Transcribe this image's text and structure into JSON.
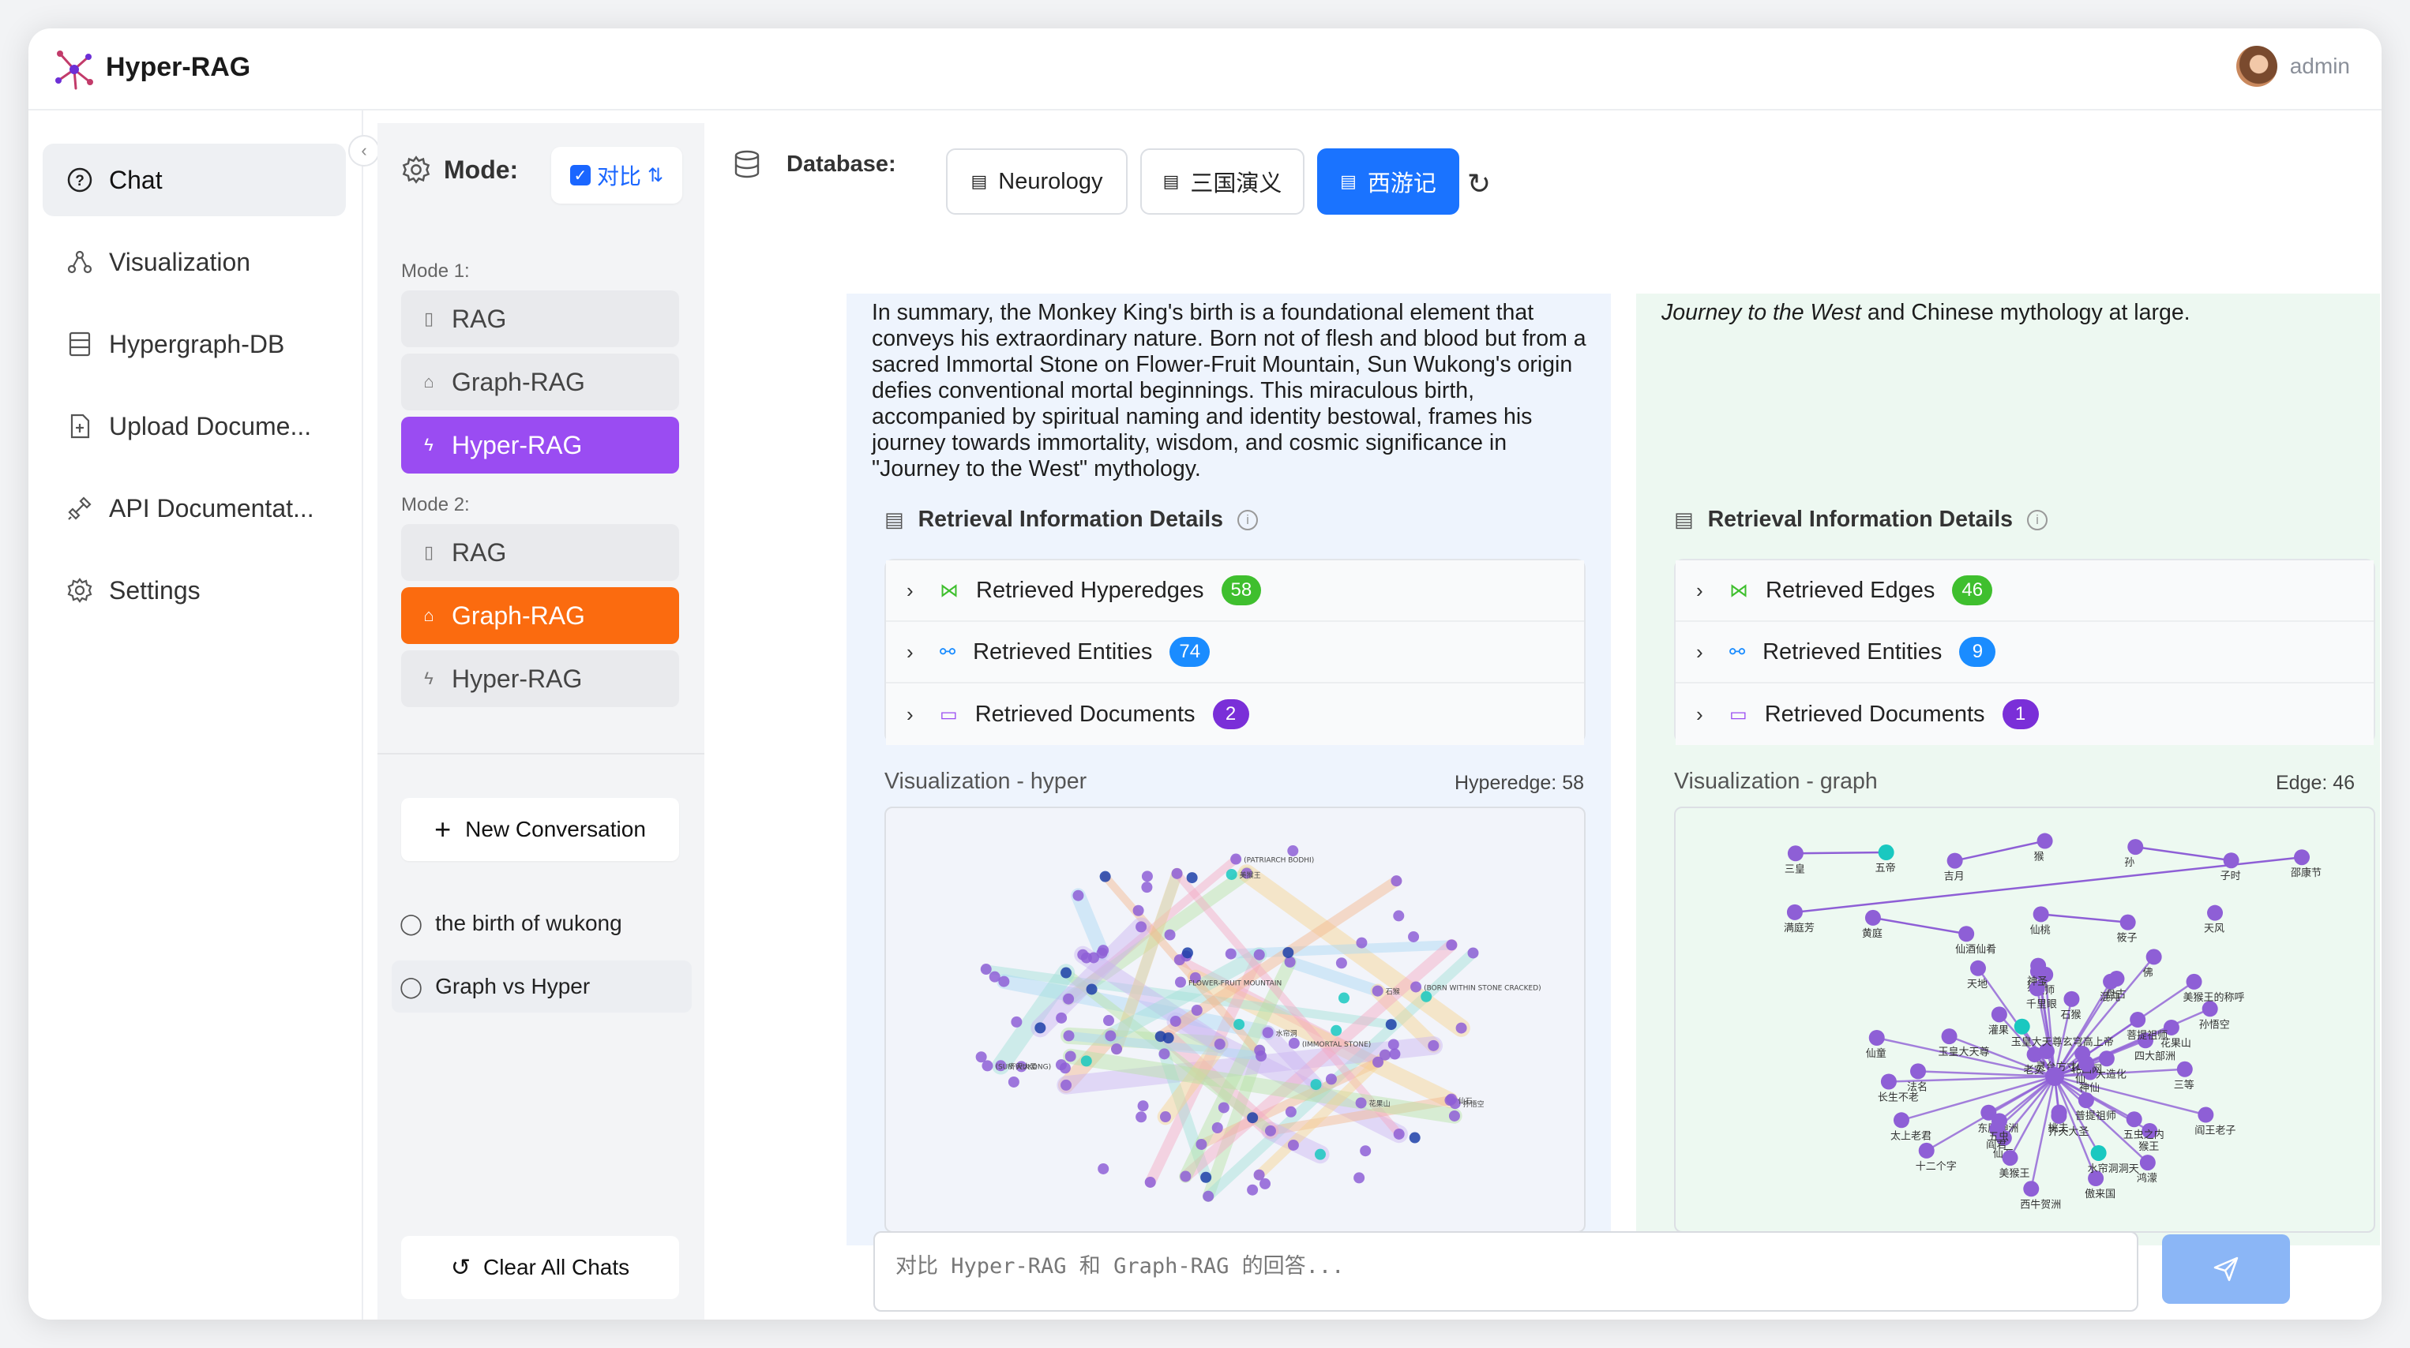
{
  "app": {
    "title": "Hyper-RAG",
    "user": "admin"
  },
  "sidebar": {
    "items": [
      {
        "label": "Chat",
        "icon": "question-circle-icon"
      },
      {
        "label": "Visualization",
        "icon": "graph-icon"
      },
      {
        "label": "Hypergraph-DB",
        "icon": "database-icon"
      },
      {
        "label": "Upload Docume...",
        "icon": "file-upload-icon"
      },
      {
        "label": "API Documentat...",
        "icon": "api-icon"
      },
      {
        "label": "Settings",
        "icon": "gear-icon"
      }
    ]
  },
  "modes": {
    "title": "Mode:",
    "compare_label": "对比",
    "mode1_label": "Mode 1:",
    "mode2_label": "Mode 2:",
    "mode1": [
      "RAG",
      "Graph-RAG",
      "Hyper-RAG"
    ],
    "mode2": [
      "RAG",
      "Graph-RAG",
      "Hyper-RAG"
    ],
    "new_conversation": "New Conversation",
    "conversations": [
      "the birth of wukong",
      "Graph vs Hyper"
    ],
    "clear_all": "Clear All Chats"
  },
  "database": {
    "label": "Database:",
    "options": [
      "Neurology",
      "三国演义",
      "西游记"
    ],
    "selected": "西游记"
  },
  "left_panel": {
    "summary": "In summary, the Monkey King's birth is a foundational element that conveys his extraordinary nature. Born not of flesh and blood but from a sacred Immortal Stone on Flower-Fruit Mountain, Sun Wukong's origin defies conventional mortal beginnings. This miraculous birth, accompanied by spiritual naming and identity bestowal, frames his journey towards immortality, wisdom, and cosmic significance in \"Journey to the West\" mythology.",
    "retrieval_title": "Retrieval Information Details",
    "rows": [
      {
        "label": "Retrieved Hyperedges",
        "count": "58"
      },
      {
        "label": "Retrieved Entities",
        "count": "74"
      },
      {
        "label": "Retrieved Documents",
        "count": "2"
      }
    ],
    "viz_title": "Visualization - hyper",
    "viz_count": "Hyperedge: 58",
    "graph_labels": [
      "仙石",
      "花果山",
      "孙悟空",
      "石猴",
      "美猴王",
      "齐天大圣",
      "水帘洞",
      "FLOWER-FRUIT MOUNTAIN",
      "(IMMORTAL STONE)",
      "(SUN WUKONG)",
      "(PATRIARCH BODHI)",
      "(BORN WITHIN STONE CRACKED)"
    ]
  },
  "right_panel": {
    "summary_em": "Journey to the West",
    "summary_rest": " and Chinese mythology at large.",
    "retrieval_title": "Retrieval Information Details",
    "rows": [
      {
        "label": "Retrieved Edges",
        "count": "46"
      },
      {
        "label": "Retrieved Entities",
        "count": "9"
      },
      {
        "label": "Retrieved Documents",
        "count": "1"
      }
    ],
    "viz_title": "Visualization - graph",
    "viz_count": "Edge: 46",
    "graph_labels": [
      "三皇",
      "五帝",
      "吉月",
      "猴",
      "孙",
      "子时",
      "邵康节",
      "满庭芳",
      "黄庭",
      "仙酒仙肴",
      "仙桃",
      "筱子",
      "天风",
      "孙悟空",
      "十二个字",
      "四大部洲",
      "法名",
      "玉皇大天尊",
      "东胜神洲",
      "傲来国",
      "神仙",
      "轮回网",
      "仙石",
      "花果山",
      "老实",
      "桃夫",
      "相师",
      "猴王",
      "齐天大圣",
      "石猴",
      "仙童",
      "天地",
      "阎君",
      "美猴王",
      "菩提祖师",
      "盘古",
      "猴子",
      "水帘洞洞天",
      "长生不老",
      "鸿濛",
      "大造化",
      "灵台方寸山",
      "美猴王的称呼",
      "太上老君",
      "混沌",
      "西牛贺洲",
      "阎王老子",
      "普提祖师",
      "灌果",
      "五虫之内",
      "三等",
      "五虫",
      "仙",
      "千里眼",
      "神圣",
      "佛",
      "玉皇大天尊玄穹高上帝"
    ]
  },
  "input": {
    "placeholder": "对比 Hyper-RAG 和 Graph-RAG 的回答..."
  },
  "colors": {
    "accent": "#1a73ff",
    "hyper": "#9a4cf2",
    "graph": "#fb6b0f",
    "node": "#8e5fd6",
    "node_alt": "#19c8c0"
  }
}
